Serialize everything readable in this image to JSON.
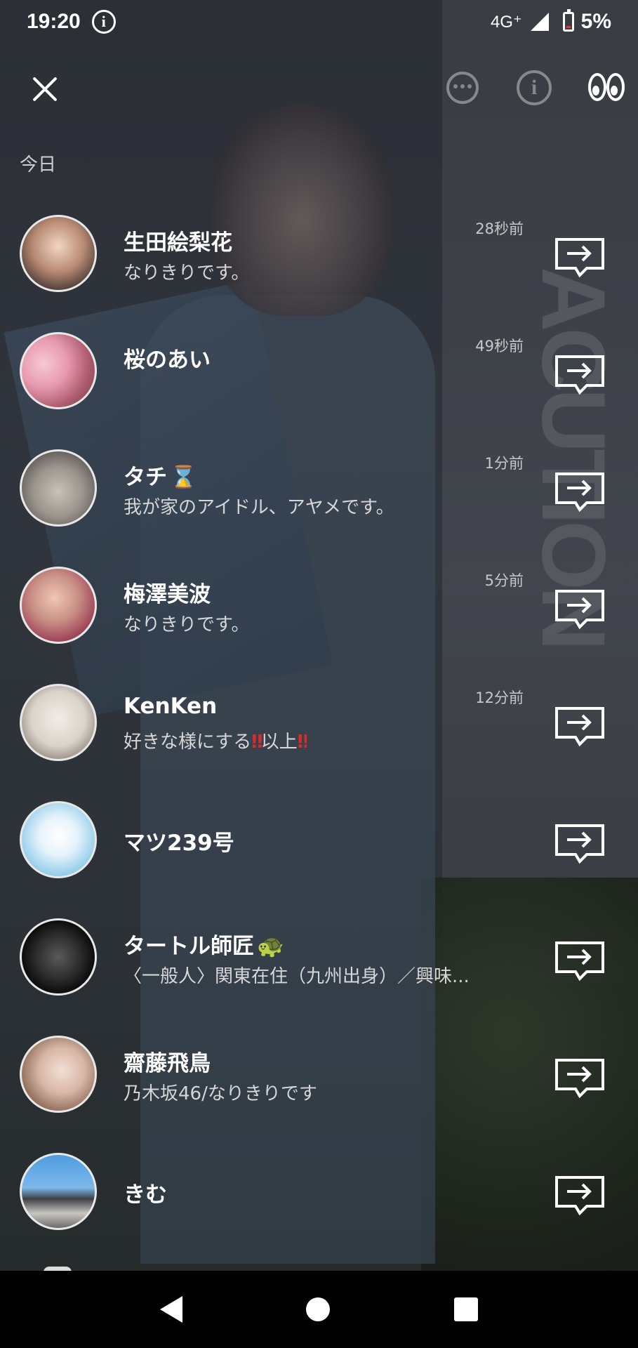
{
  "status_bar": {
    "time": "19:20",
    "info_glyph": "i",
    "network": "4G⁺",
    "battery": "5%"
  },
  "toolbar": {
    "icons": [
      "close-icon",
      "chat-dots-icon",
      "info-icon",
      "eyes-icon"
    ]
  },
  "section": {
    "label": "今日"
  },
  "rows": [
    {
      "name": "生田絵梨花",
      "name_emoji": "",
      "subtitle": "なりきりです。",
      "time": "28秒前"
    },
    {
      "name": "桜のあい",
      "name_emoji": "",
      "subtitle": "",
      "time": "49秒前"
    },
    {
      "name": "タチ",
      "name_emoji": "⌛",
      "subtitle": "我が家のアイドル、アヤメです。",
      "time": "1分前"
    },
    {
      "name": "梅澤美波",
      "name_emoji": "",
      "subtitle": "なりきりです。",
      "time": "5分前"
    },
    {
      "name": "KenKen",
      "name_emoji": "",
      "subtitle_parts": [
        "好きな様にする",
        "‼",
        "以上",
        "‼"
      ],
      "time": "12分前"
    },
    {
      "name": "マツ239号",
      "name_emoji": "",
      "subtitle": "",
      "time": ""
    },
    {
      "name": "タートル師匠",
      "name_emoji": "🐢",
      "subtitle": "〈一般人〉関東在住（九州出身）／興味...",
      "time": ""
    },
    {
      "name": "齋藤飛鳥",
      "name_emoji": "",
      "subtitle": "乃木坂46/なりきりです",
      "time": ""
    },
    {
      "name": "きむ",
      "name_emoji": "",
      "subtitle": "",
      "time": ""
    }
  ],
  "colors": {
    "accent_red": "#e02a2a",
    "hourglass_magenta": "#d52bd6",
    "turtle_green": "#3a9a3a"
  }
}
